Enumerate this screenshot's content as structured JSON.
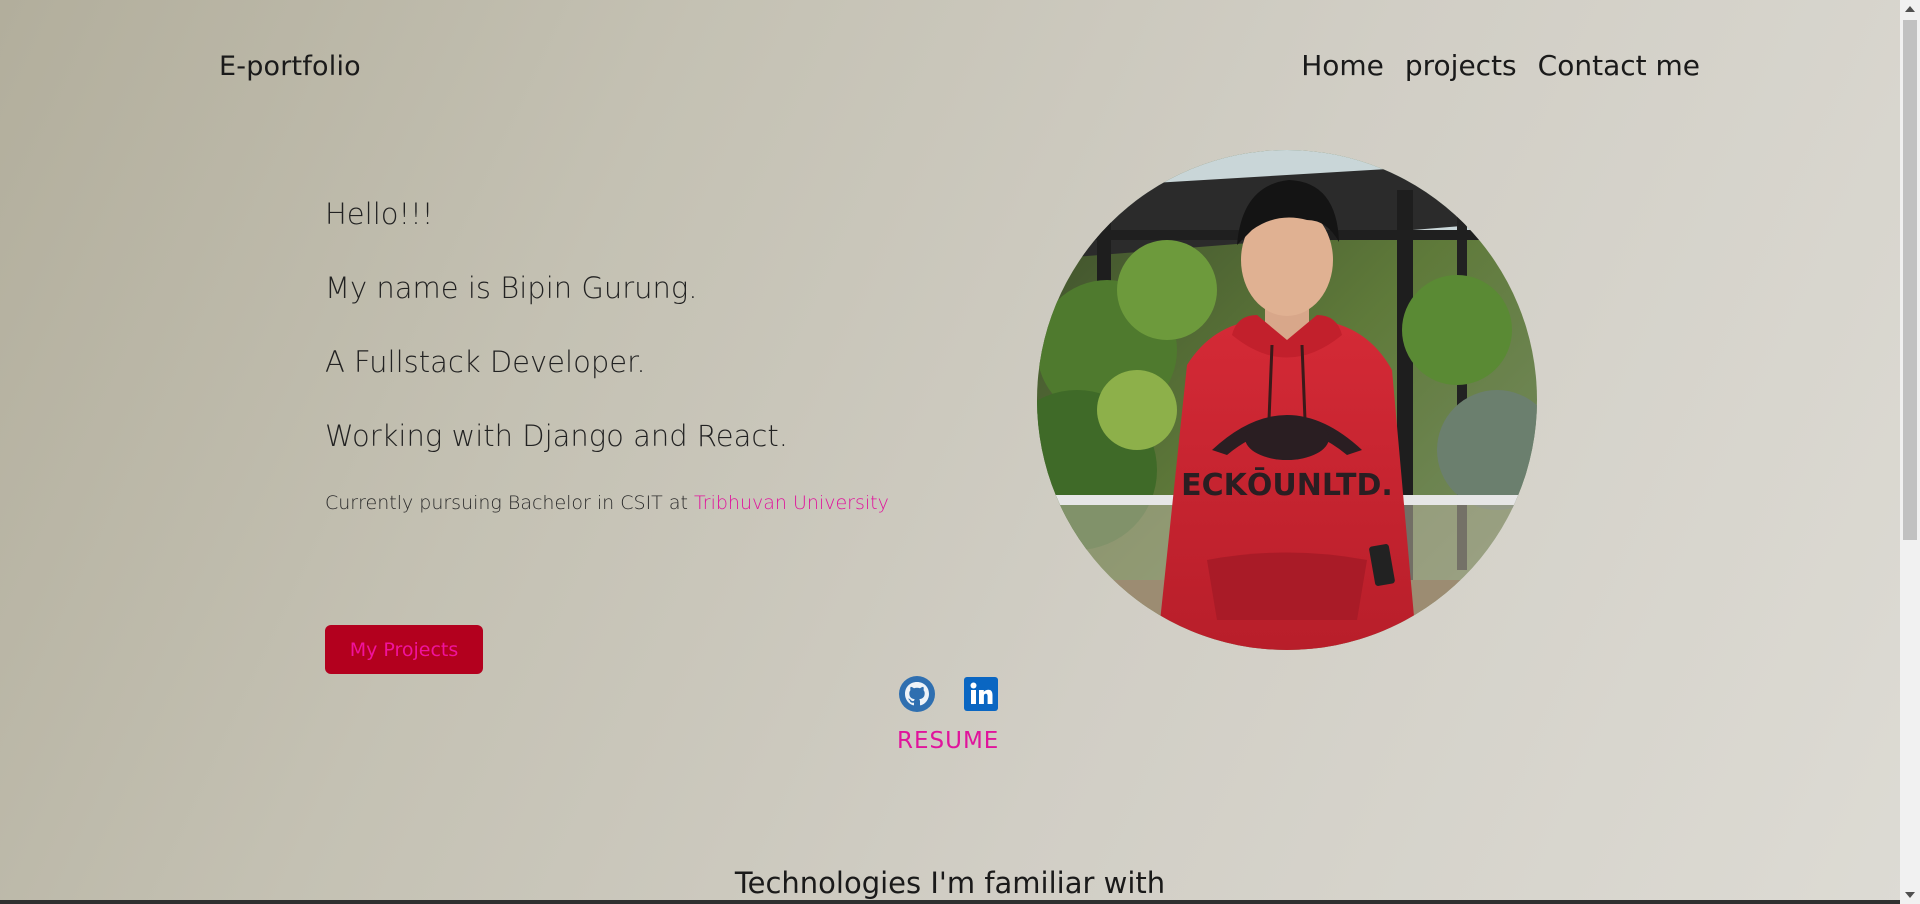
{
  "header": {
    "brand": "E-portfolio",
    "nav": [
      "Home",
      "projects",
      "Contact me"
    ]
  },
  "intro": {
    "greeting": "Hello!!!",
    "name_line": "My name is Bipin Gurung.",
    "role_line": "A Fullstack Developer.",
    "stack_line": "Working with Django and React.",
    "study_prefix": "Currently pursuing Bachelor in CSIT at",
    "university": "Tribhuvan University"
  },
  "cta": {
    "projects_button": "My Projects"
  },
  "socials": {
    "icons": [
      "github-icon",
      "linkedin-icon"
    ],
    "resume": "RESUME"
  },
  "section": {
    "technologies_heading": "Technologies I'm familiar with"
  },
  "colors": {
    "accent": "#e0149c",
    "button_bg": "#b3001e",
    "linkedin": "#0a66c2"
  }
}
